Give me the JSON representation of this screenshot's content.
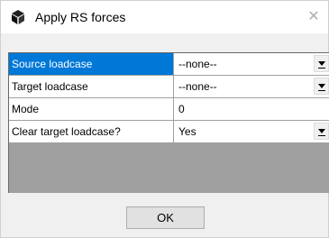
{
  "window": {
    "title": "Apply RS forces",
    "close_glyph": "✕"
  },
  "grid": {
    "rows": [
      {
        "label": "Source loadcase",
        "value": "--none--",
        "dropdown": true,
        "selected": true
      },
      {
        "label": "Target loadcase",
        "value": "--none--",
        "dropdown": true,
        "selected": false
      },
      {
        "label": "Mode",
        "value": "0",
        "dropdown": false,
        "selected": false
      },
      {
        "label": "Clear target loadcase?",
        "value": "Yes",
        "dropdown": true,
        "selected": false
      }
    ]
  },
  "buttons": {
    "ok_label": "OK"
  },
  "colors": {
    "selection": "#0078d7",
    "grid_background": "#a0a0a0"
  }
}
